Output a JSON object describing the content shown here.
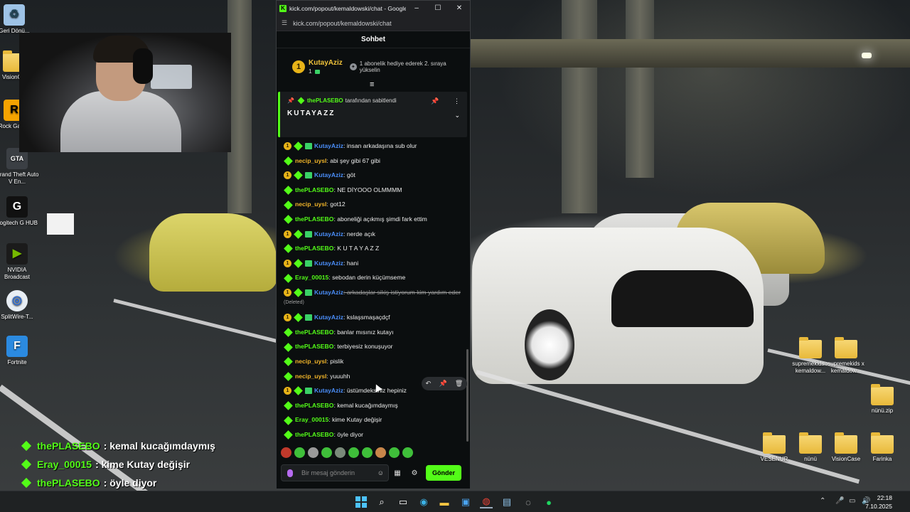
{
  "browser": {
    "tab_title": "kick.com/popout/kemaldowski/chat - Google...",
    "url": "kick.com/popout/kemaldowski/chat",
    "minimize": "–",
    "maximize": "☐",
    "close": "✕"
  },
  "chat": {
    "header": "Sohbet",
    "gift_leader": {
      "rank": "1",
      "username": "KutayAziz",
      "count": "1",
      "message": "1 abonelik hediye ederek 2. sırayа yükselin"
    },
    "pinned": {
      "pinned_by": "thePLASEBO",
      "pinned_suffix": "tarafından sabitlendi",
      "text": "KUTAYAZZ"
    },
    "messages": [
      {
        "user": "KutayAziz",
        "type": "kutay",
        "text": ": insan arkadaşına sub olur"
      },
      {
        "user": "necip_uysl",
        "type": "necip",
        "text": ": abi şey gibi 67 gibi"
      },
      {
        "user": "KutayAziz",
        "type": "kutay",
        "text": ": göt"
      },
      {
        "user": "thePLASEBO",
        "type": "plasebo",
        "text": ": NE DİYOOO OLMMMM"
      },
      {
        "user": "necip_uysl",
        "type": "necip",
        "text": ": got12"
      },
      {
        "user": "thePLASEBO",
        "type": "plasebo",
        "text": ": aboneliği açıkmış şimdi fark ettim"
      },
      {
        "user": "KutayAziz",
        "type": "kutay",
        "text": ": nerde açık"
      },
      {
        "user": "thePLASEBO",
        "type": "plasebo",
        "text": ": K U T A Y A Z Z"
      },
      {
        "user": "KutayAziz",
        "type": "kutay",
        "text": ": hani"
      },
      {
        "user": "Eray_00015",
        "type": "eray",
        "text": ": sebodan derin küçümseme"
      },
      {
        "user": "KutayAziz",
        "type": "kutay-deleted",
        "text": ": arkadaşlar sikiş istiyorum kim yardım eder",
        "tag": "(Deleted)"
      },
      {
        "user": "KutayAziz",
        "type": "kutay",
        "text": ": kslaşsmaşaçdçf"
      },
      {
        "user": "thePLASEBO",
        "type": "plasebo",
        "text": ": banlar mısınız kutayı"
      },
      {
        "user": "thePLASEBO",
        "type": "plasebo",
        "text": ": terbiyesiz konuşuyor"
      },
      {
        "user": "necip_uysl",
        "type": "necip",
        "text": ": pislik"
      },
      {
        "user": "necip_uysl",
        "type": "necip",
        "text": ": yuuuhh"
      },
      {
        "user": "KutayAziz",
        "type": "kutay",
        "text": ": üstümdeksiniz hepiniz"
      },
      {
        "user": "thePLASEBO",
        "type": "plasebo",
        "text": ": kemal kucağımdaymış"
      },
      {
        "user": "Eray_00015",
        "type": "eray",
        "text": ": kime Kutay değişir"
      },
      {
        "user": "thePLASEBO",
        "type": "plasebo",
        "text": ": öyle diyor"
      }
    ],
    "input_placeholder": "Bir mesaj gönderin",
    "send_label": "Gönder"
  },
  "overlay": [
    {
      "user": "thePLASEBO",
      "text": ": kemal kucağımdaymış"
    },
    {
      "user": "Eray_00015",
      "text": ": kime Kutay değişir"
    },
    {
      "user": "thePLASEBO",
      "text": ": öyle diyor"
    }
  ],
  "desktop_icons": {
    "recycle": "Geri Dönü...",
    "vision": "VisionC...",
    "rockstar": "Rock Gam...",
    "gta": "Grand Theft Auto V En...",
    "logitech": "Logitech G HUB",
    "nvidia": "NVIDIA Broadcast",
    "splitwire": "SplitWire-T...",
    "fortnite": "Fortnite",
    "supremekids1": "supremekids x kemaldow...",
    "supremekids2": "supremekids x kemaldow...",
    "nunuzip": "nünü.zip",
    "vesenur": "VESENUR",
    "nunu": "nünü",
    "visioncase": "VisionCase",
    "farinka": "Farinka"
  },
  "taskbar": {
    "time": "22:18",
    "date": "7.10.2025"
  },
  "colors": {
    "kick_green": "#53fc18",
    "gold": "#e7b318",
    "kutay_blue": "#4a8df8",
    "necip_orange": "#f0b429"
  }
}
